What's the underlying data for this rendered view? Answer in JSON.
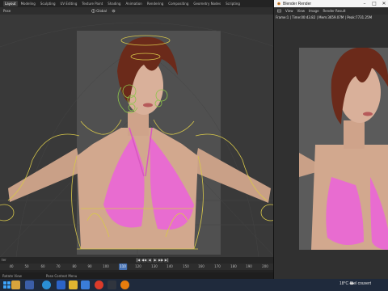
{
  "blender": {
    "workspace_tabs": [
      "Layout",
      "Modeling",
      "Sculpting",
      "UV Editing",
      "Texture Paint",
      "Shading",
      "Animation",
      "Rendering",
      "Compositing",
      "Geometry Nodes",
      "Scripting"
    ],
    "active_tab": "Layout",
    "viewport_header": {
      "mode": "Pose",
      "transform_orientation": "Global",
      "pivot_icon": "pivot-icon"
    },
    "timeline": {
      "label": "ter",
      "frame_ticks": [
        "40",
        "50",
        "60",
        "70",
        "80",
        "90",
        "100",
        "110",
        "120",
        "130",
        "140",
        "150",
        "160",
        "170",
        "180",
        "190",
        "200"
      ],
      "current_frame": "110",
      "playback_buttons": [
        "|◀",
        "◀◀",
        "◀",
        "▶",
        "▶▶",
        "▶|"
      ]
    },
    "status_bar": {
      "left": "Rotate View",
      "middle": "Pose Context Menu"
    }
  },
  "render_window": {
    "title": "Blender Render",
    "toolbar": {
      "view_label": "View",
      "view2_label": "View",
      "image_label": "Image",
      "slot_label": "Render Result"
    },
    "info": "Frame:1 | Time:00:43.82 | Mem:3659.07M | Peak:7731.25M"
  },
  "taskbar": {
    "weather_temp": "18°C",
    "weather_desc": "Ciel couvert"
  },
  "colors": {
    "rig_yellow": "#d8c84a",
    "rig_green": "#8dc44a",
    "bikini_pink": "#e86cd0",
    "hair_brown": "#6b2a1a",
    "skin": "#d4aa90",
    "active_frame_blue": "#4772b3"
  }
}
